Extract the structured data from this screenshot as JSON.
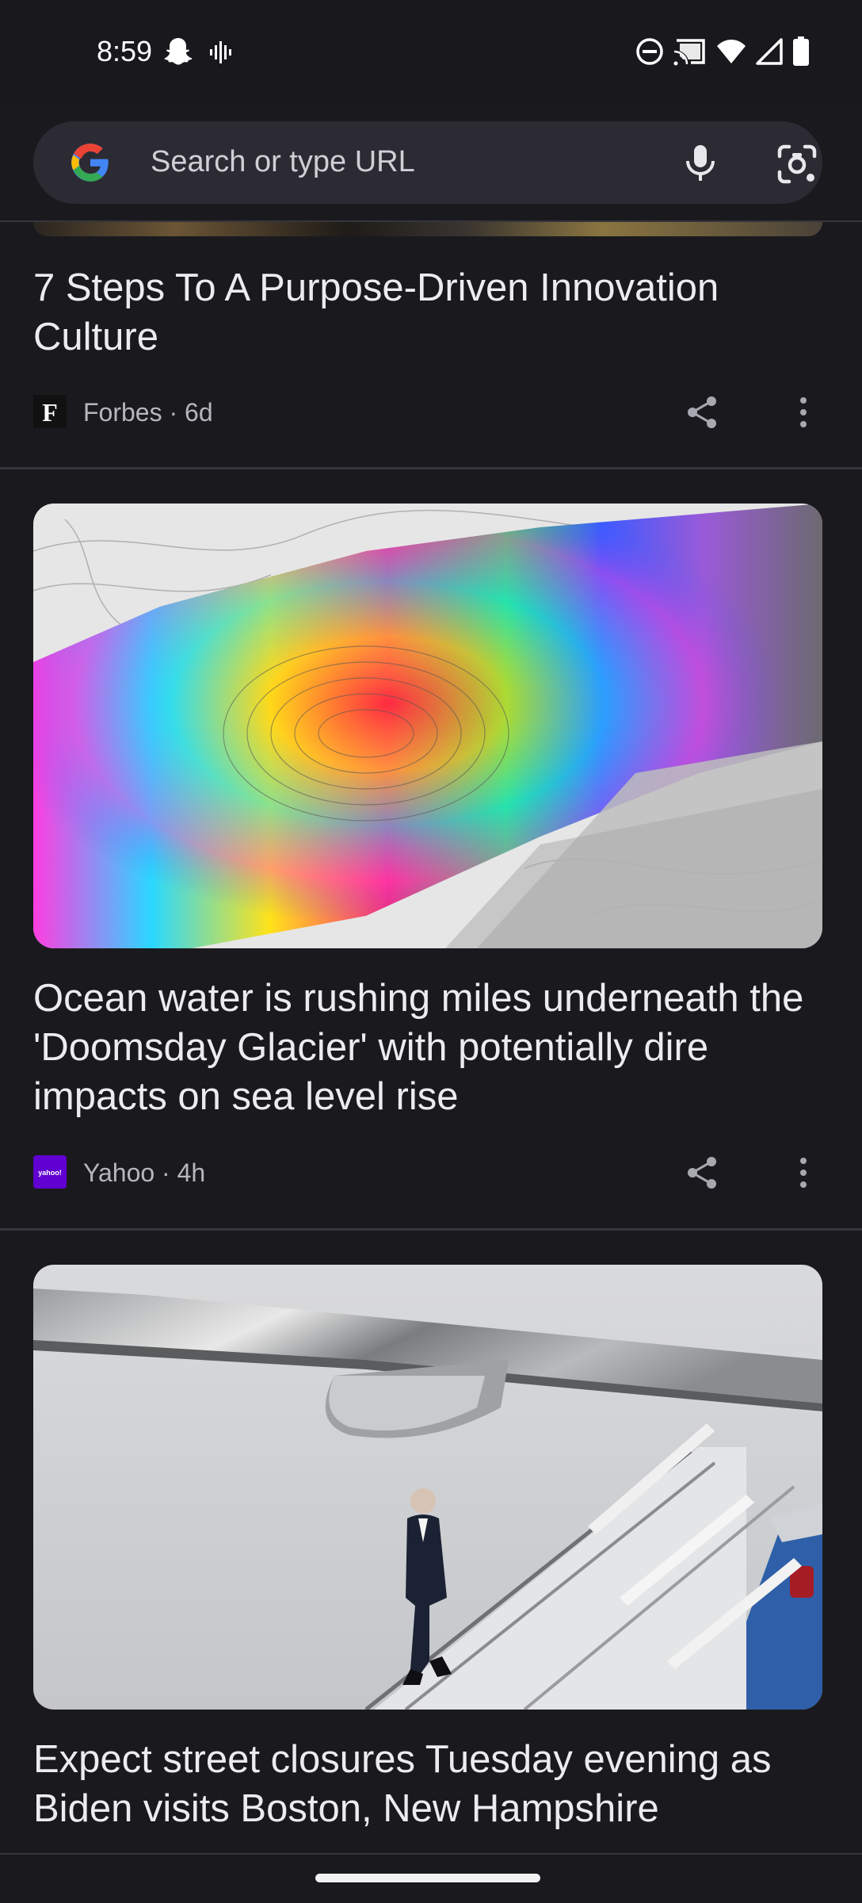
{
  "status_bar": {
    "time": "8:59",
    "left_icons": [
      "snapchat-icon",
      "waveform-icon"
    ],
    "right_icons": [
      "do-not-disturb-icon",
      "cast-icon",
      "wifi-icon",
      "signal-icon",
      "battery-icon"
    ]
  },
  "search": {
    "placeholder": "Search or type URL",
    "icons": [
      "google-g-icon",
      "mic-icon",
      "lens-icon"
    ]
  },
  "feed": {
    "articles": [
      {
        "title": "7 Steps To A Purpose-Driven Innovation Culture",
        "source": "Forbes · 6d",
        "logo_letter": "F"
      },
      {
        "title": "Ocean water is rushing miles underneath the 'Doomsday Glacier' with potentially dire impacts on sea level rise",
        "source": "Yahoo · 4h",
        "logo_text": "yahoo!"
      },
      {
        "title": "Expect street closures Tuesday evening as Biden visits Boston, New Hampshire"
      }
    ]
  },
  "colors": {
    "background": "#1a1a1e",
    "search_bar": "#2c2b33",
    "divider": "#35353b",
    "yahoo_purple": "#6001d2"
  }
}
